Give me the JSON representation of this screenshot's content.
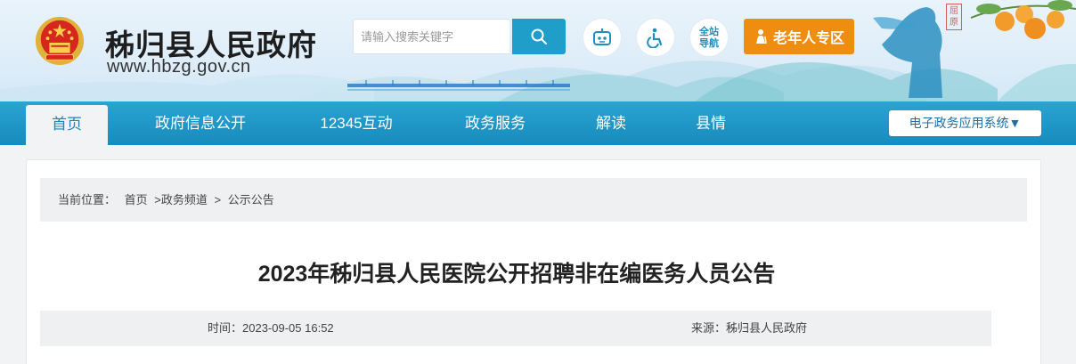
{
  "header": {
    "site_title": "秭归县人民政府",
    "site_domain": "www.hbzg.gov.cn",
    "search_placeholder": "请输入搜索关键字",
    "nav_guide_label": "全站导航",
    "elder_zone_label": "老年人专区",
    "seal_text": "屈原",
    "icons": [
      "national-emblem-icon",
      "search-icon",
      "robot-icon",
      "accessibility-icon",
      "elder-person-icon"
    ]
  },
  "nav": {
    "items": [
      {
        "label": "首页",
        "active": true
      },
      {
        "label": "政府信息公开",
        "active": false
      },
      {
        "label": "12345互动",
        "active": false
      },
      {
        "label": "政务服务",
        "active": false
      },
      {
        "label": "解读",
        "active": false
      },
      {
        "label": "县情",
        "active": false
      }
    ],
    "eservice_label": "电子政务应用系统▼"
  },
  "breadcrumb": {
    "prefix": "当前位置：",
    "items": [
      "首页",
      ">政务频道",
      ">",
      "公示公告"
    ]
  },
  "article": {
    "title": "2023年秭归县人民医院公开招聘非在编医务人员公告",
    "time_label": "时间：",
    "time_value": "2023-09-05 16:52",
    "source_label": "来源：",
    "source_value": "秭归县人民政府"
  },
  "colors": {
    "nav_blue": "#1f9ec9",
    "elder_orange": "#ee8d10",
    "emblem_red": "#d7261d"
  }
}
